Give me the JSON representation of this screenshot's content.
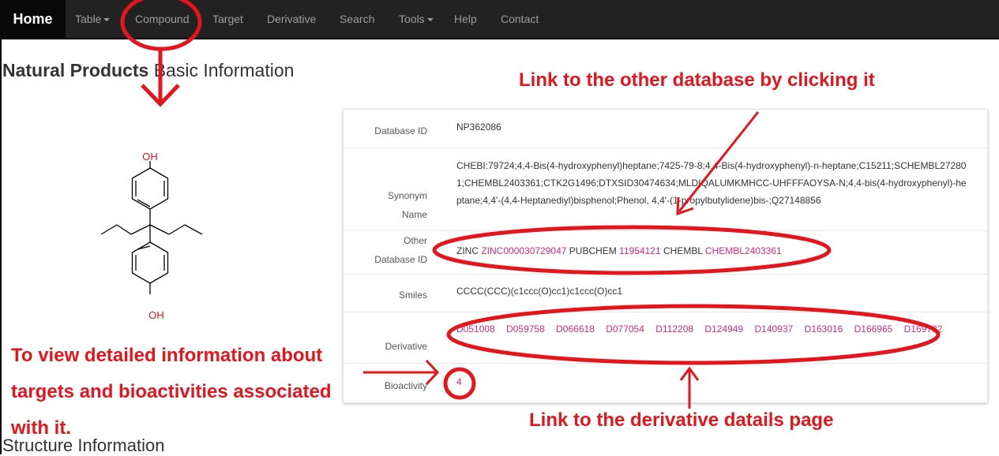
{
  "nav": {
    "home": "Home",
    "items": [
      "Table",
      "Compound",
      "Target",
      "Derivative",
      "Search",
      "Tools",
      "Help",
      "Contact"
    ]
  },
  "page": {
    "title_bold": "Natural Products",
    "title_rest": " Basic Information",
    "structure_title": "Structure Information"
  },
  "molecule": {
    "oh_top": "OH",
    "oh_bottom": "OH"
  },
  "info": {
    "database_id_label": "Database ID",
    "database_id": "NP362086",
    "synonym_label_1": "Synonym",
    "synonym_label_2": "Name",
    "synonym": "CHEBI:79724;4,4-Bis(4-hydroxyphenyl)heptane;7425-79-8;4,4-Bis(4-hydroxyphenyl)-n-heptane;C15211;SCHEMBL272801;CHEMBL2403361;CTK2G1496;DTXSID30474634;MLDIQALUMKMHCC-UHFFFAOYSA-N;4,4-bis(4-hydroxyphenyl)-heptane;4,4'-(4,4-Heptanediyl)bisphenol;Phenol, 4,4'-(1-propylbutylidene)bis-;Q27148856",
    "other_db_label_1": "Other",
    "other_db_label_2": "Database ID",
    "zinc_label": "ZINC",
    "zinc_id": "ZINC000030729047",
    "pubchem_label": "PUBCHEM",
    "pubchem_id": "11954121",
    "chembl_label": "CHEMBL",
    "chembl_id": "CHEMBL2403361",
    "smiles_label": "Smiles",
    "smiles": "CCCC(CCC)(c1ccc(O)cc1)c1ccc(O)cc1",
    "derivative_label": "Derivative",
    "derivatives": [
      "D051008",
      "D059758",
      "D066618",
      "D077054",
      "D112208",
      "D124949",
      "D140937",
      "D163016",
      "D166965",
      "D169782"
    ],
    "bioactivity_label": "Bioactivity",
    "bioactivity": "4"
  },
  "annotations": {
    "top": "Link to the other database by clicking it",
    "left": "To view detailed information about targets and bioactivities associated with it.",
    "bottom": "Link to the derivative datails page"
  },
  "colors": {
    "annotation": "#e3161d",
    "link": "#d6297f",
    "navbar": "#222222"
  }
}
